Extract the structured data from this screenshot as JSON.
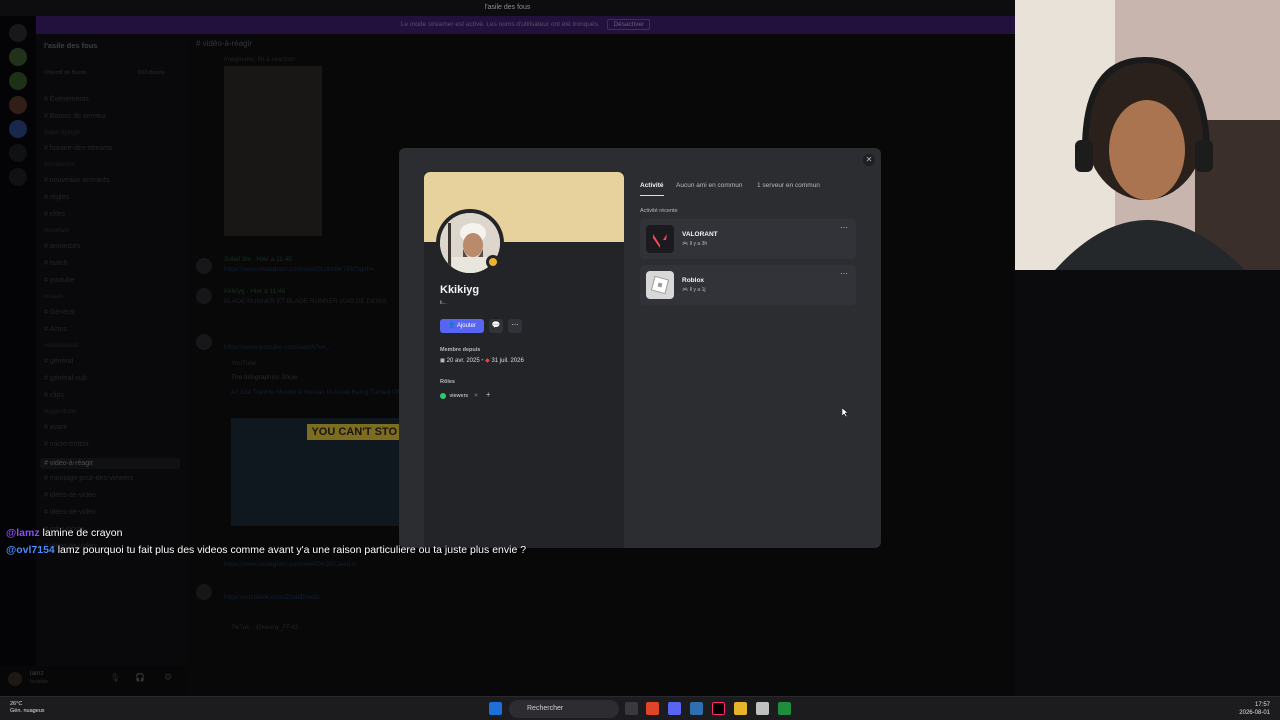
{
  "window": {
    "title": "l'asile des fous"
  },
  "banner": {
    "text": "Le mode streamer est activé. Les noms d'utilisateur ont été tronqués.",
    "button": "Désactiver"
  },
  "server": {
    "name": "l'asile des fous",
    "boost": "Objectif de Boost",
    "boost_count": "0/10 Boosts"
  },
  "channels": {
    "items": [
      {
        "label": "Événements",
        "cat": false
      },
      {
        "label": "Boosts de serveur",
        "cat": false
      },
      {
        "label": "Salon épinglé",
        "cat": true
      },
      {
        "label": "horaire-des-streams",
        "cat": false
      },
      {
        "label": "introduction",
        "cat": true
      },
      {
        "label": "nouveaux-arrivants",
        "cat": false
      },
      {
        "label": "règles",
        "cat": false
      },
      {
        "label": "rôles",
        "cat": false
      },
      {
        "label": "important",
        "cat": true
      },
      {
        "label": "annonces",
        "cat": false
      },
      {
        "label": "twitch",
        "cat": false
      },
      {
        "label": "youtube",
        "cat": false
      },
      {
        "label": "vocaux",
        "cat": true
      },
      {
        "label": "Général",
        "cat": false
      },
      {
        "label": "Actus",
        "cat": false
      },
      {
        "label": "communauté",
        "cat": true
      },
      {
        "label": "général",
        "cat": false
      },
      {
        "label": "général-sub",
        "cat": false
      },
      {
        "label": "clips",
        "cat": false
      },
      {
        "label": "suggestions",
        "cat": true
      },
      {
        "label": "avant",
        "cat": false
      },
      {
        "label": "micro-trottoir",
        "cat": false
      },
      {
        "label": "vidéo-à-réagir",
        "cat": false,
        "active": true
      },
      {
        "label": "montage-pour-des-viewers",
        "cat": false
      },
      {
        "label": "idées-de-vidéo",
        "cat": false
      },
      {
        "label": "idées-de-vidéo",
        "cat": false
      },
      {
        "label": "infos-poste",
        "cat": false
      },
      {
        "label": "idées-de-vidéo",
        "cat": false
      }
    ]
  },
  "chat": {
    "channel": "vidéo-à-réagir",
    "lines": [
      {
        "text": "imaginaire: fin à réaction",
        "cls": ""
      },
      {
        "text": "Soleil·3m · Hier à 11:45",
        "cls": "green"
      },
      {
        "text": "https://www.instagram.com/reel/DLnlm8K7fR/?igsh=...",
        "cls": "link"
      },
      {
        "text": "Kkikiyg · Hier à 11:46",
        "cls": "green"
      },
      {
        "text": "BLADE RUNNER ET BLADE RUNNER 2049 DE DENIS",
        "cls": ""
      },
      {
        "text": "https://www.youtube.com/watch?v=...",
        "cls": "link"
      },
      {
        "text": "YouTube",
        "cls": ""
      },
      {
        "text": "The Infographics Show",
        "cls": ""
      },
      {
        "text": "AI Just Tried to Murder a Human to Avoid Being Turned Off",
        "cls": "link"
      },
      {
        "text": "https://www.instagram.com/reel/DKdBCaeil1c/",
        "cls": "link"
      },
      {
        "text": "https://vm.tiktok.com/ZNd6Emd5/",
        "cls": "link"
      },
      {
        "text": "TikTok · @kenny_FF43",
        "cls": ""
      }
    ],
    "thumbnail_caption": "YOU CAN'T STO"
  },
  "profile": {
    "username": "Kkikiyg",
    "subtitle": "k...",
    "add_label": "Ajouter",
    "member_since_label": "Membre depuis",
    "member_since_discord": "20 avr. 2025",
    "member_since_server": "31 juil. 2026",
    "roles_label": "Rôles",
    "role": "viewers"
  },
  "tabs": [
    {
      "label": "Activité"
    },
    {
      "label": "Aucun ami en commun"
    },
    {
      "label": "1 serveur en commun"
    }
  ],
  "activity": {
    "label": "Activité récente",
    "items": [
      {
        "name": "VALORANT",
        "time": "Il y a 3h"
      },
      {
        "name": "Roblox",
        "time": "Il y a 1j"
      }
    ]
  },
  "overlay_chat": [
    {
      "tag": "@lamz",
      "text": "lamine de crayon"
    },
    {
      "tag": "@ovl7154",
      "text": "lamz pourquoi tu fait plus des videos comme avant y'a une raison particuliere ou ta juste plus envie ?"
    }
  ],
  "userbar": {
    "name": "lamz",
    "status": "Invisible"
  },
  "taskbar": {
    "temp": "26°C",
    "weather": "Gén. nuageux",
    "search": "Rechercher",
    "time": "17:57",
    "date": "2026-08-01"
  },
  "colors": {
    "accent": "#5865f2",
    "banner": "#3e1f6e",
    "status": "#f0b232",
    "role": "#2ecc71",
    "valorant": "#ff4655"
  },
  "icons": [
    "close-icon",
    "message-icon",
    "more-icon",
    "controller-icon",
    "search-icon",
    "windows-icon"
  ]
}
